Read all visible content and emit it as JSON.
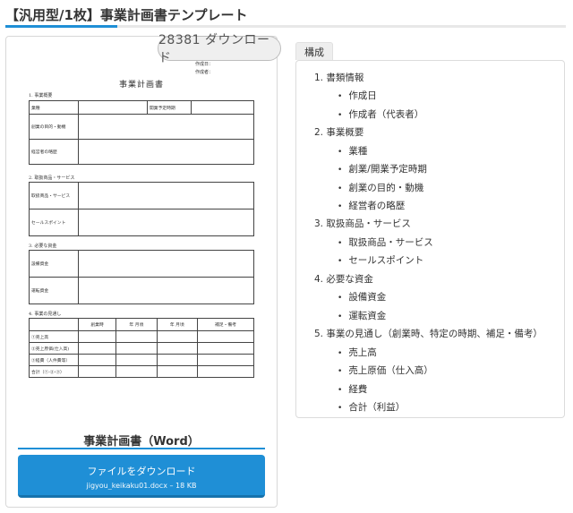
{
  "page_title": "【汎用型/1枚】事業計画書テンプレート",
  "colors": {
    "accent": "#1f8fd6",
    "badge_bg": "#efefef"
  },
  "download_count": "28381 ダウンロード",
  "doc_preview": {
    "created_date": "作成日：",
    "author": "作成者：",
    "title": "事業計画書",
    "sections": [
      {
        "heading": "1. 事業概要",
        "business_type": "業種",
        "start_period": "開業予定時期",
        "purpose": "創業の目的・動機",
        "career": "経営者の略歴"
      },
      {
        "heading": "2. 取扱商品・サービス",
        "products": "取扱商品・サービス",
        "selling_points": "セールスポイント"
      },
      {
        "heading": "3. 必要な資金",
        "equipment": "設備資金",
        "operating": "運転資金"
      },
      {
        "heading": "4. 事業の見通し",
        "col_founding": "創業時",
        "col_ym1": "年 月頃",
        "col_ym2": "年 月頃",
        "col_note": "補足・備考",
        "row1": "①売上高",
        "row2": "②売上原価(仕入高)",
        "row3": "③経費（人件費等）",
        "row4": "合計（①-②-③）"
      }
    ]
  },
  "card_title": "事業計画書（Word）",
  "download_button": {
    "label": "ファイルをダウンロード",
    "file_info": "jigyou_keikaku01.docx – 18 KB"
  },
  "contents_tab": "構成",
  "contents": [
    {
      "label": "1. 書類情報",
      "items": [
        "作成日",
        "作成者（代表者）"
      ]
    },
    {
      "label": "2. 事業概要",
      "items": [
        "業種",
        "創業/開業予定時期",
        "創業の目的・動機",
        "経営者の略歴"
      ]
    },
    {
      "label": "3. 取扱商品・サービス",
      "items": [
        "取扱商品・サービス",
        "セールスポイント"
      ]
    },
    {
      "label": "4. 必要な資金",
      "items": [
        "設備資金",
        "運転資金"
      ]
    },
    {
      "label": "5. 事業の見通し（創業時、特定の時期、補足・備考）",
      "items": [
        "売上高",
        "売上原価（仕入高）",
        "経費",
        "合計（利益）"
      ]
    }
  ]
}
